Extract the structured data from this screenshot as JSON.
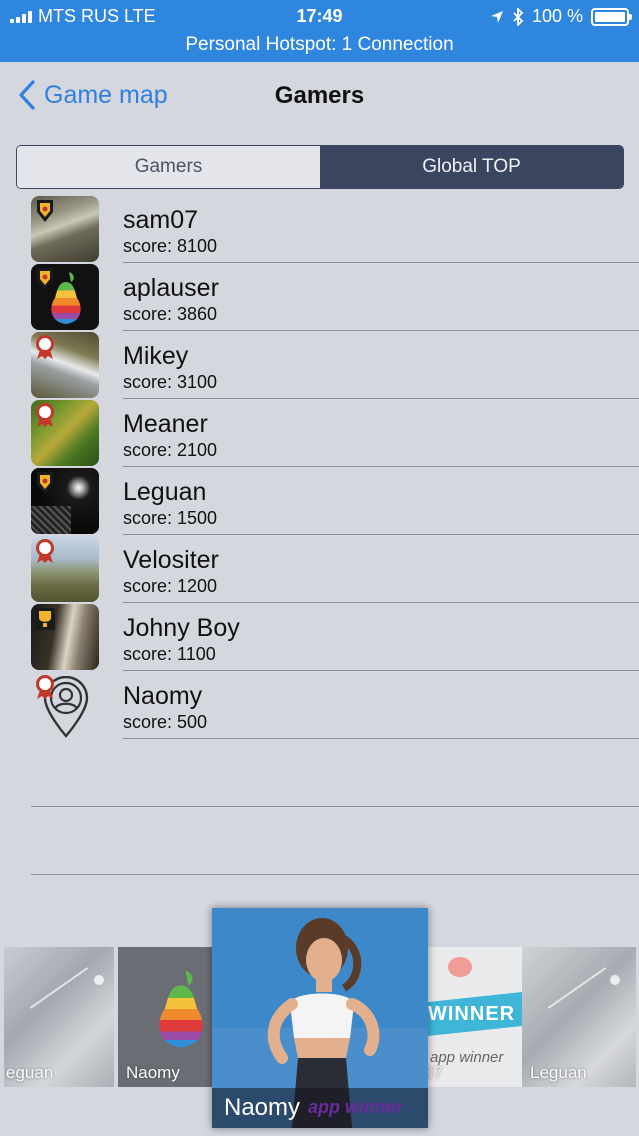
{
  "status_bar": {
    "carrier": "MTS RUS   LTE",
    "time": "17:49",
    "battery": "100 %",
    "hotspot": "Personal Hotspot: 1 Connection",
    "signal_bars": 4
  },
  "nav": {
    "back_label": "Game map",
    "title": "Gamers"
  },
  "segments": {
    "gamers": "Gamers",
    "global_top": "Global TOP",
    "selected": "Global TOP"
  },
  "players": [
    {
      "name": "sam07",
      "score": "score: 8100",
      "badge": "trophy-badge-icon"
    },
    {
      "name": "aplauser",
      "score": "score: 3860",
      "badge": "trophy-badge-icon"
    },
    {
      "name": "Mikey",
      "score": "score: 3100",
      "badge": "rosette-badge-icon"
    },
    {
      "name": "Meaner",
      "score": "score: 2100",
      "badge": "rosette-badge-icon"
    },
    {
      "name": "Leguan",
      "score": "score: 1500",
      "badge": "trophy-badge-icon"
    },
    {
      "name": "Velositer",
      "score": "score: 1200",
      "badge": "rosette-badge-icon"
    },
    {
      "name": "Johny Boy",
      "score": "score: 1100",
      "badge": "cup-badge-icon"
    },
    {
      "name": "Naomy",
      "score": "score: 500",
      "badge": "rosette-badge-icon"
    }
  ],
  "carousel": {
    "cards": [
      {
        "label": "eguan"
      },
      {
        "label": "Naomy"
      },
      {
        "label": "Naomy",
        "watermark": "app winner"
      },
      {
        "label": "07",
        "banner": "WINNER",
        "watermark": "app winner"
      },
      {
        "label": "Leguan"
      }
    ]
  },
  "colors": {
    "status_bar": "#2f86de",
    "accent": "#2f80e0",
    "segment_selected": "#3a4560",
    "background": "#d4d7de"
  }
}
